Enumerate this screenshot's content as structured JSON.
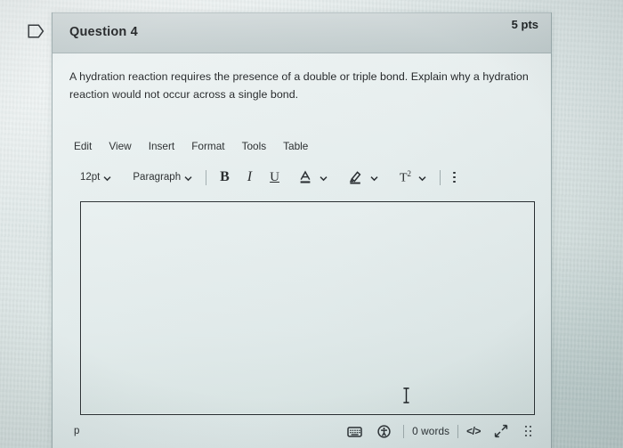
{
  "page": {
    "flag_icon": "bookmark-flag-icon"
  },
  "question_card": {
    "title": "Question 4",
    "points": "5 pts",
    "prompt": "A hydration reaction requires the presence of a double or triple bond. Explain why a hydration reaction would not occur across a single bond."
  },
  "editor": {
    "menubar": [
      {
        "label": "Edit"
      },
      {
        "label": "View"
      },
      {
        "label": "Insert"
      },
      {
        "label": "Format"
      },
      {
        "label": "Tools"
      },
      {
        "label": "Table"
      }
    ],
    "toolbar": {
      "font_size": "12pt",
      "block_format": "Paragraph",
      "bold": "B",
      "italic": "I",
      "underline": "U",
      "text_color": "A",
      "highlight": "highlighter-icon",
      "superscript": "T",
      "superscript_exponent": "2",
      "more": "kebab-menu-icon"
    },
    "content": "",
    "cursor": "text-cursor-i-beam"
  },
  "status_bar": {
    "element_path": "p",
    "keyboard_icon": "keyboard-icon",
    "accessibility_icon": "accessibility-icon",
    "word_count": "0 words",
    "source_code": "</>",
    "resize_icon": "resize-diagonal-icon",
    "drag_handle": "drag-handle-icon"
  },
  "colors": {
    "background": "#dbe4e4",
    "card": "#e6eeee",
    "header": "#c9d2d3",
    "text": "#191b1d",
    "border": "#1e2326"
  }
}
